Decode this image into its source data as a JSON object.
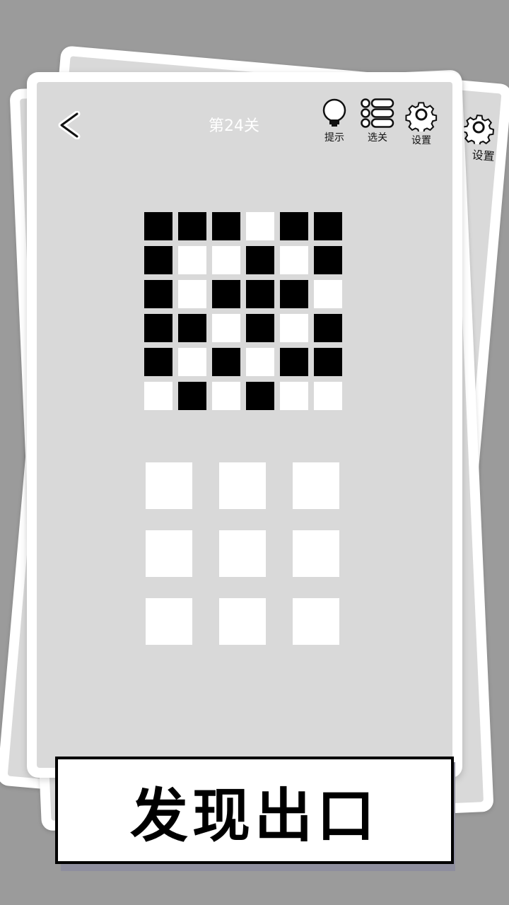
{
  "header": {
    "level_title": "第24关",
    "hint_label": "提示",
    "level_select_label": "选关",
    "settings_label": "设置"
  },
  "back_card": {
    "settings_label": "设置"
  },
  "puzzle": {
    "rows": 6,
    "cols": 6,
    "cells": [
      [
        1,
        1,
        1,
        0,
        1,
        1
      ],
      [
        1,
        0,
        0,
        1,
        0,
        1
      ],
      [
        1,
        0,
        1,
        1,
        1,
        0
      ],
      [
        1,
        1,
        0,
        1,
        0,
        1
      ],
      [
        1,
        0,
        1,
        0,
        1,
        1
      ],
      [
        0,
        1,
        0,
        1,
        0,
        0
      ]
    ]
  },
  "answer_choices": {
    "count": 9
  },
  "banner": {
    "text": "发现出口"
  },
  "colors": {
    "background": "#9b9b9b",
    "card_border": "#ffffff",
    "card_face": "#d9d9d9",
    "cell_filled": "#000000",
    "cell_empty": "#ffffff"
  }
}
